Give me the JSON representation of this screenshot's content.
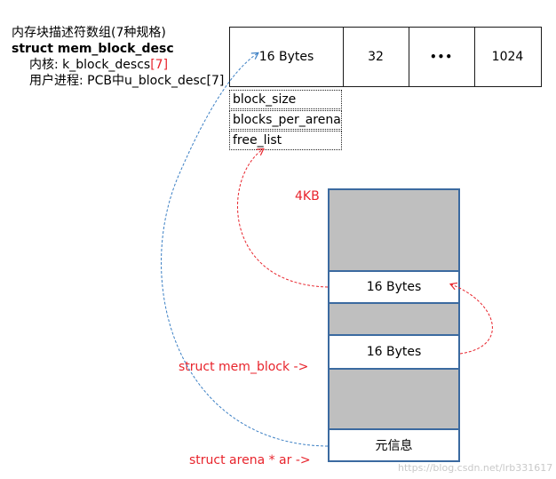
{
  "notes": {
    "line1": "内存块描述符数组(7种规格)",
    "line2": "struct mem_block_desc",
    "line3_prefix": "内核: k_block_descs",
    "line3_index": "[7]",
    "line4": "用户进程: PCB中u_block_desc[7]"
  },
  "top_row": {
    "cells": [
      "16 Bytes",
      "32",
      "•••",
      "1024"
    ]
  },
  "desc_fields": [
    "block_size",
    "blocks_per_arena",
    "free_list"
  ],
  "arena": {
    "size_label": "4KB",
    "block1": "16 Bytes",
    "block2": "16 Bytes",
    "meta": "元信息"
  },
  "pointers": {
    "mem_block": "struct mem_block ->",
    "arena": "struct arena * ar ->"
  },
  "watermark": "https://blog.csdn.net/lrb331617",
  "colors": {
    "red_arrow": "#e8242c",
    "blue_arrow": "#3b7fc4",
    "stack_border": "#3b6aa0",
    "stack_fill": "#bfbfbf"
  }
}
